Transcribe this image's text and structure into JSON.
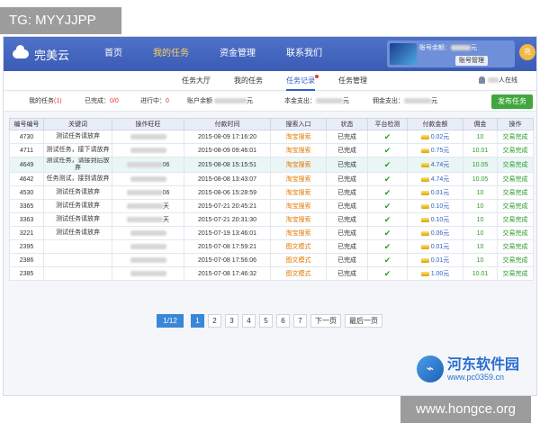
{
  "tag_top": "TG: MYYJJPP",
  "footer_watermark": "www.hongce.org",
  "app": {
    "logo": "完美云",
    "nav": [
      "首页",
      "我的任务",
      "资金管理",
      "联系我们"
    ],
    "account": {
      "line1": "账号余额：",
      "line1_suffix": "元",
      "button": "账号管理",
      "avatar": "充"
    },
    "subtabs": [
      "任务大厅",
      "我的任务",
      "任务记录",
      "任务管理"
    ],
    "online": "人在线"
  },
  "stats": {
    "my_tasks_label": "我的任务",
    "my_tasks_value": "(1)",
    "done_label": "已完成：",
    "done_value": "0/0",
    "inprog_label": "进行中：",
    "inprog_value": "0",
    "balance_label": "账户余额",
    "balance_suffix": "元",
    "spend_label": "本金支出：",
    "spend_suffix": "元",
    "comm_label": "佣金支出：",
    "comm_suffix": "元",
    "publish": "发布任务"
  },
  "table": {
    "headers": [
      "编号编号",
      "关键词",
      "操作旺旺",
      "付款时间",
      "搜索入口",
      "状态",
      "平台检测",
      "付款金额",
      "佣金",
      "操作"
    ],
    "rows": [
      {
        "id": "4730",
        "kw": "测试任务请放弃",
        "ww": "",
        "time": "2015-08-09 17:16:20",
        "entry": "淘宝搜索",
        "status": "已完成",
        "amount": "0.02元",
        "comm": "10",
        "op": "交易完成"
      },
      {
        "id": "4711",
        "kw": "测试任务，接下请放弃",
        "ww": "",
        "time": "2015-08-09 09:46:01",
        "entry": "淘宝搜索",
        "status": "已完成",
        "amount": "0.75元",
        "comm": "10.01",
        "op": "交易完成"
      },
      {
        "id": "4649",
        "kw": "测试任务，请接到后放弃",
        "ww": "06",
        "time": "2015-08-08 15:15:51",
        "entry": "淘宝搜索",
        "status": "已完成",
        "amount": "4.74元",
        "comm": "10.05",
        "op": "交易完成"
      },
      {
        "id": "4642",
        "kw": "任务测试，接到请放弃",
        "ww": "",
        "time": "2015-08-08 13:43:07",
        "entry": "淘宝搜索",
        "status": "已完成",
        "amount": "4.74元",
        "comm": "10.05",
        "op": "交易完成"
      },
      {
        "id": "4530",
        "kw": "测试任务请放弃",
        "ww": "06",
        "time": "2015-08-06 15:28:59",
        "entry": "淘宝搜索",
        "status": "已完成",
        "amount": "0.01元",
        "comm": "10",
        "op": "交易完成"
      },
      {
        "id": "3365",
        "kw": "测试任务请放弃",
        "ww": "天",
        "time": "2015-07-21 20:45:21",
        "entry": "淘宝搜索",
        "status": "已完成",
        "amount": "0.10元",
        "comm": "10",
        "op": "交易完成"
      },
      {
        "id": "3363",
        "kw": "测试任务请放弃",
        "ww": "天",
        "time": "2015-07-21 20:31:30",
        "entry": "淘宝搜索",
        "status": "已完成",
        "amount": "0.10元",
        "comm": "10",
        "op": "交易完成"
      },
      {
        "id": "3221",
        "kw": "测试任务请放弃",
        "ww": "",
        "time": "2015-07-19 13:46:01",
        "entry": "淘宝搜索",
        "status": "已完成",
        "amount": "0.06元",
        "comm": "10",
        "op": "交易完成"
      },
      {
        "id": "2395",
        "kw": "",
        "ww": "",
        "time": "2015-07-08 17:59:21",
        "entry": "图文模式",
        "status": "已完成",
        "amount": "0.01元",
        "comm": "10",
        "op": "交易完成"
      },
      {
        "id": "2386",
        "kw": "",
        "ww": "",
        "time": "2015-07-08 17:56:06",
        "entry": "图文模式",
        "status": "已完成",
        "amount": "0.01元",
        "comm": "10",
        "op": "交易完成"
      },
      {
        "id": "2385",
        "kw": "",
        "ww": "",
        "time": "2015-07-08 17:46:32",
        "entry": "图文模式",
        "status": "已完成",
        "amount": "1.00元",
        "comm": "10.01",
        "op": "交易完成"
      }
    ]
  },
  "pager": {
    "info": "1/12",
    "pages": [
      "1",
      "2",
      "3",
      "4",
      "5",
      "6",
      "7"
    ],
    "next": "下一页",
    "last": "最后一页"
  },
  "watermark": {
    "title": "河东软件园",
    "url": "www.pc0359.cn"
  }
}
